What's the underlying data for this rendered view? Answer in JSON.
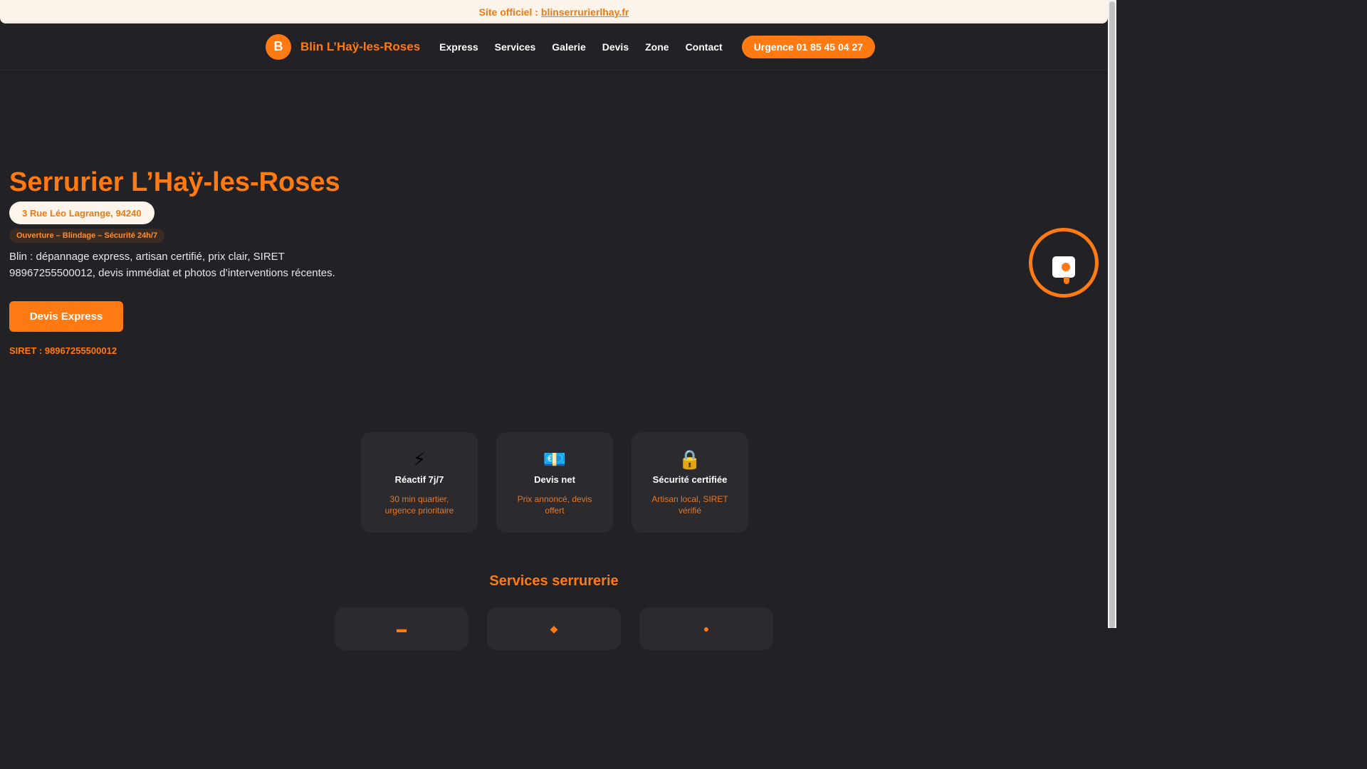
{
  "topbar": {
    "label": "Site officiel :",
    "link": "blinserrurierlhay.fr"
  },
  "header": {
    "logo_letter": "B",
    "brand": "Blin L’Haÿ-les-Roses",
    "nav": [
      "Express",
      "Services",
      "Galerie",
      "Devis",
      "Zone",
      "Contact"
    ],
    "urgent_button": "Urgence 01 85 45 04 27"
  },
  "hero": {
    "title": "Serrurier L’Haÿ-les-Roses",
    "address": "3 Rue Léo Lagrange, 94240",
    "tagline": "Ouverture – Blindage – Sécurité 24h/7",
    "description": "Blin : dépannage express, artisan certifié, prix clair, SIRET 98967255500012, devis immédiat et photos d’interventions récentes.",
    "cta": "Devis Express",
    "siret": "SIRET : 98967255500012"
  },
  "features": [
    {
      "icon": "⚡",
      "icon_name": "lightning-icon",
      "title": "Réactif 7j/7",
      "desc": "30 min quartier, urgence prioritaire"
    },
    {
      "icon": "💶",
      "icon_name": "euro-banknote-icon",
      "title": "Devis net",
      "desc": "Prix annoncé, devis offert"
    },
    {
      "icon": "🔒",
      "icon_name": "lock-icon",
      "title": "Sécurité certifiée",
      "desc": "Artisan local, SIRET vérifié"
    }
  ],
  "services": {
    "title": "Services serrurerie"
  },
  "colors": {
    "accent": "#ff7a12",
    "background": "#222226",
    "card": "#2a2a2f"
  }
}
